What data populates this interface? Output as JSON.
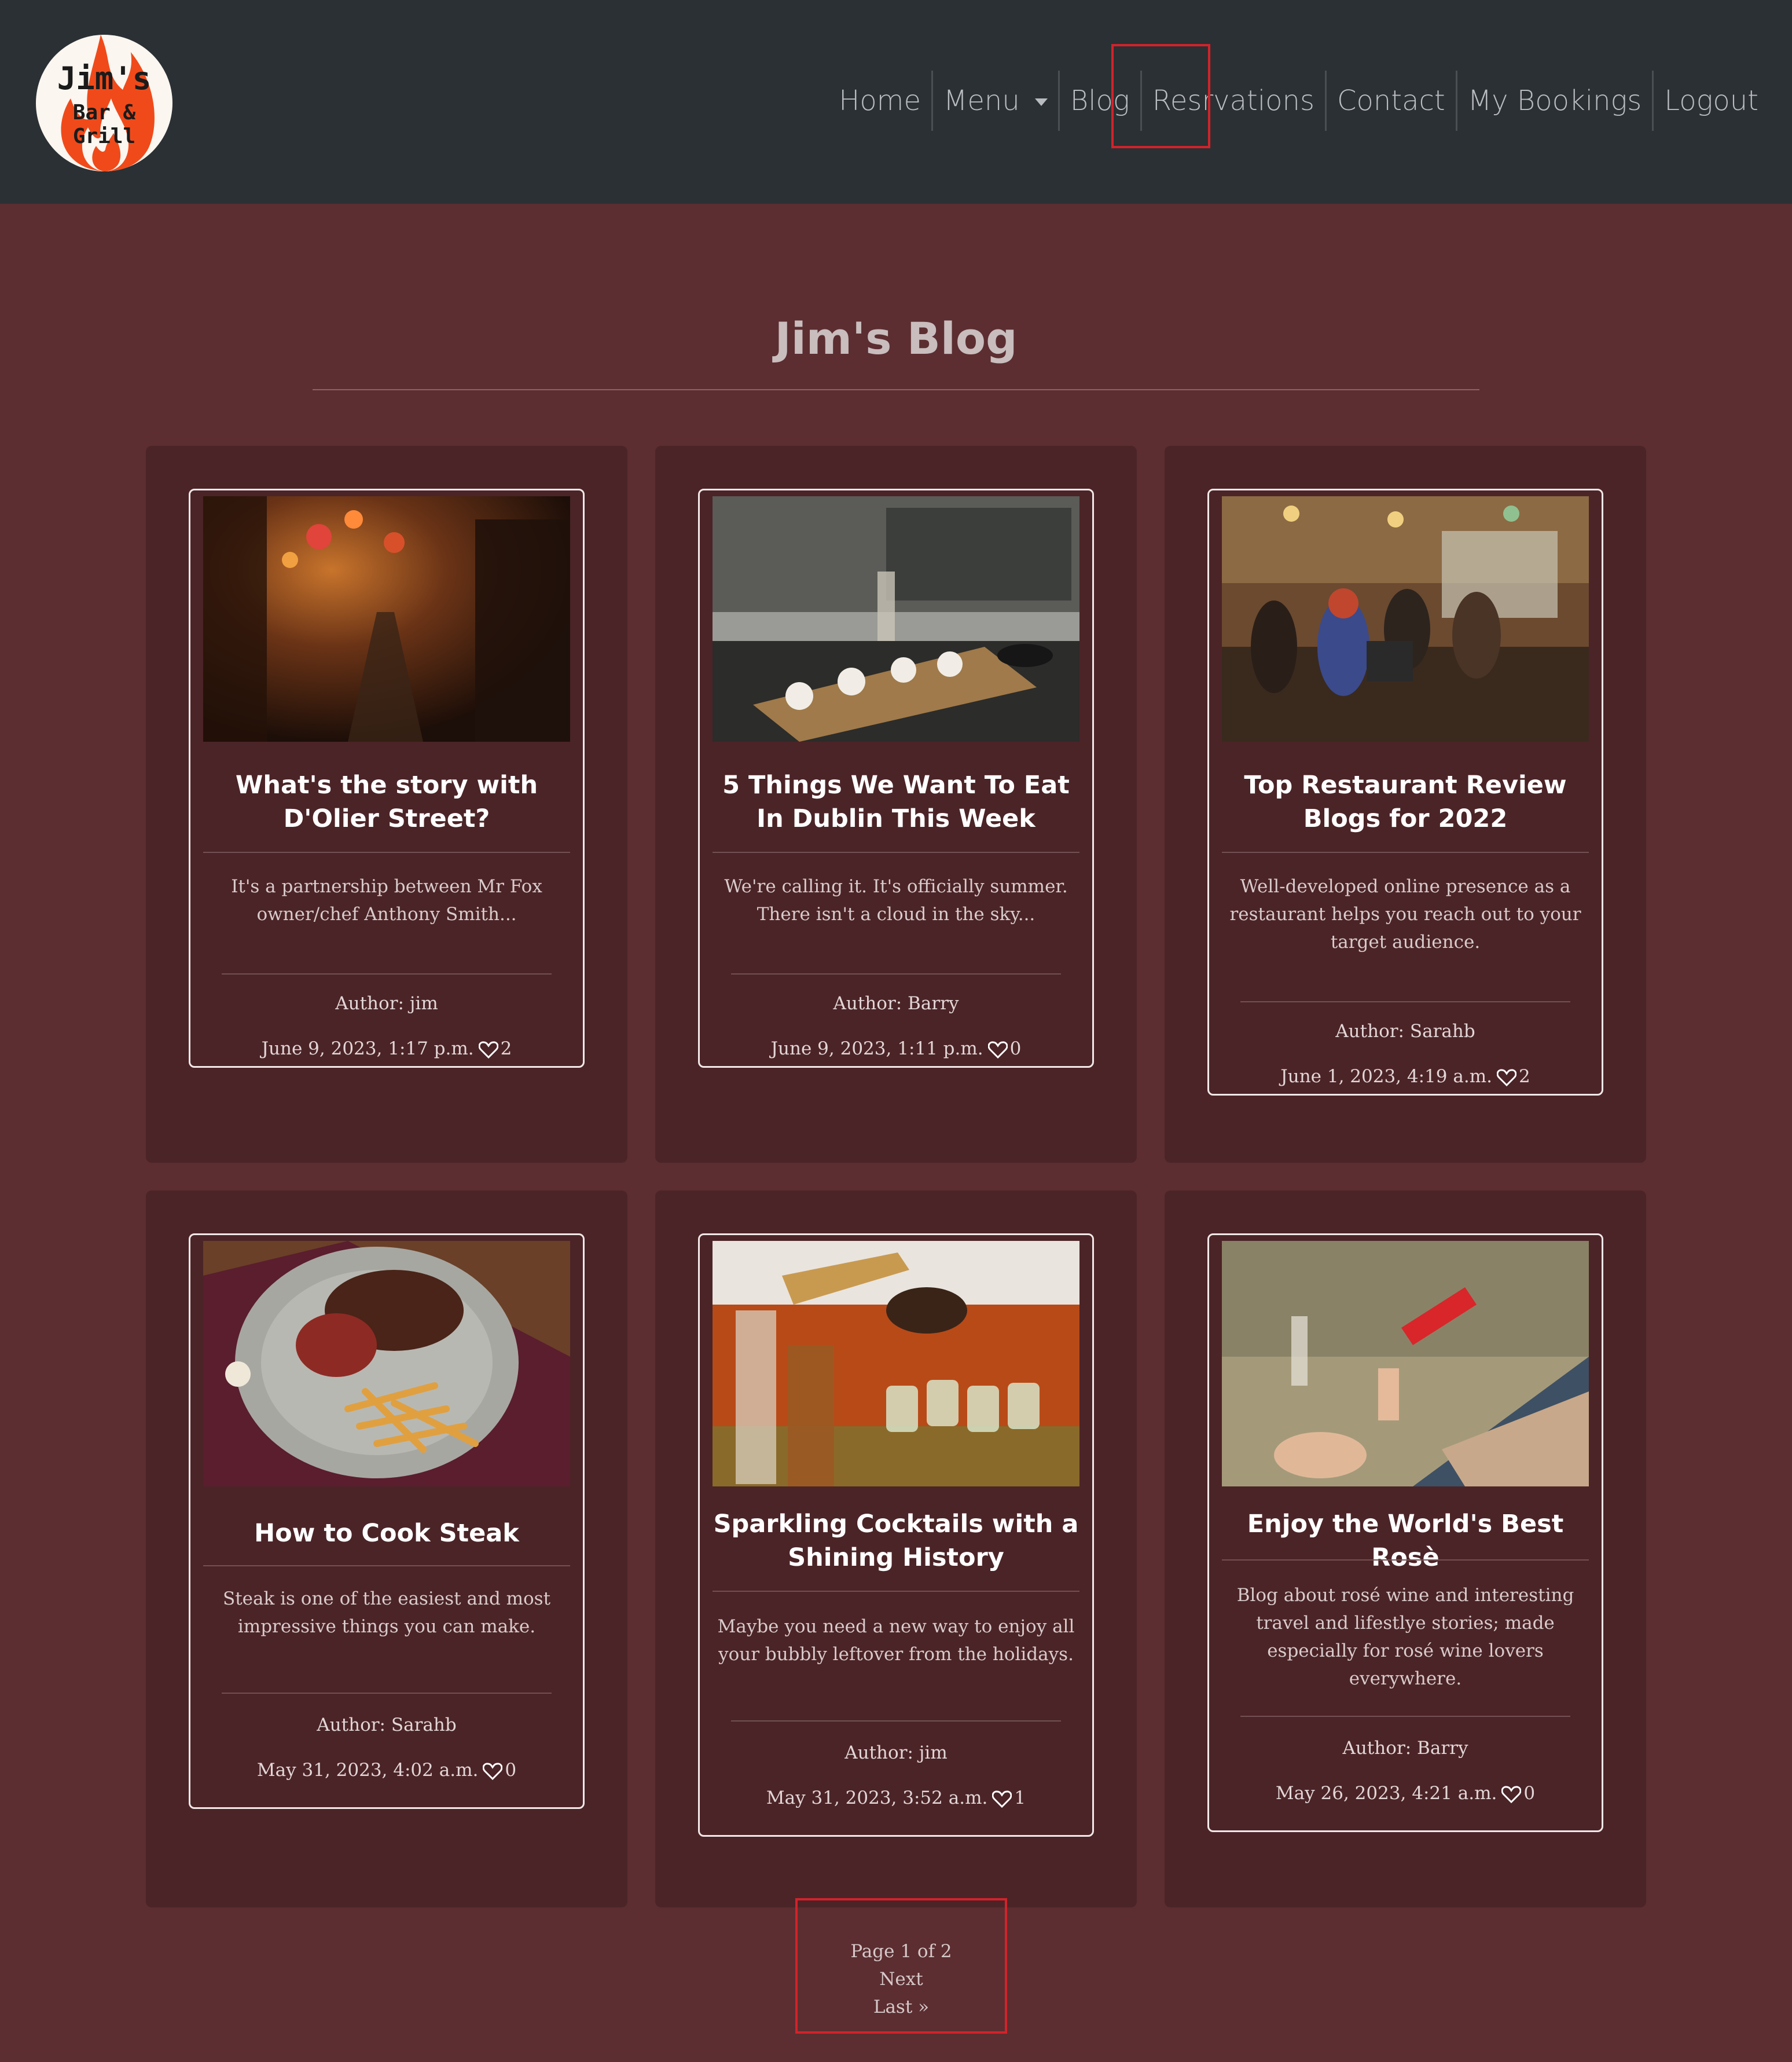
{
  "header": {
    "logo": {
      "line1": "Jim's",
      "line2": "Bar & Grill"
    },
    "nav": [
      {
        "label": "Home"
      },
      {
        "label": "Menu"
      },
      {
        "label": "Blog"
      },
      {
        "label": "Resrvations"
      },
      {
        "label": "Contact"
      },
      {
        "label": "My Bookings"
      },
      {
        "label": "Logout"
      }
    ]
  },
  "page": {
    "title": "Jim's Blog"
  },
  "posts": [
    {
      "title": "What's the story with D'Olier Street?",
      "excerpt": "It's a partnership between Mr Fox owner/chef Anthony Smith...",
      "author": "Author: jim",
      "date": "June 9, 2023, 1:17 p.m.",
      "likes": "2",
      "image": "night-alley-lanterns"
    },
    {
      "title": "5 Things We Want To Eat In Dublin This Week",
      "excerpt": "We're calling it. It's officially summer. There isn't a cloud in the sky...",
      "author": "Author: Barry",
      "date": "June 9, 2023, 1:11 p.m.",
      "likes": "0",
      "image": "tapas-board-cafe"
    },
    {
      "title": "Top Restaurant Review Blogs for 2022",
      "excerpt": "Well-developed online presence as a restaurant helps you reach out to your target audience.",
      "author": "Author: Sarahb",
      "date": "June 1, 2023, 4:19 a.m.",
      "likes": "2",
      "image": "busy-restaurant-bar"
    },
    {
      "title": "How to Cook Steak",
      "excerpt": "Steak is one of the easiest and most impressive things you can make.",
      "author": "Author: Sarahb",
      "date": "May 31, 2023, 4:02 a.m.",
      "likes": "0",
      "image": "steak-and-fries-plate"
    },
    {
      "title": "Sparkling Cocktails with a Shining History",
      "excerpt": "Maybe you need a new way to enjoy all your bubbly leftover from the holidays.",
      "author": "Author: jim",
      "date": "May 31, 2023, 3:52 a.m.",
      "likes": "1",
      "image": "bartender-pouring-cocktails"
    },
    {
      "title": "Enjoy the World's Best Rosè",
      "excerpt": "Blog about rosé wine and interesting travel and lifestlye stories; made especially for rosé wine lovers everywhere.",
      "author": "Author: Barry",
      "date": "May 26, 2023, 4:21 a.m.",
      "likes": "0",
      "image": "pouring-rose-wine"
    }
  ],
  "pagination": {
    "status": "Page 1 of 2",
    "next": "Next",
    "last": "Last »"
  },
  "colors": {
    "navbar": "#2b3034",
    "page_bg": "#5c2e31",
    "cell_bg": "#4b2427",
    "highlight": "#d3222a"
  }
}
